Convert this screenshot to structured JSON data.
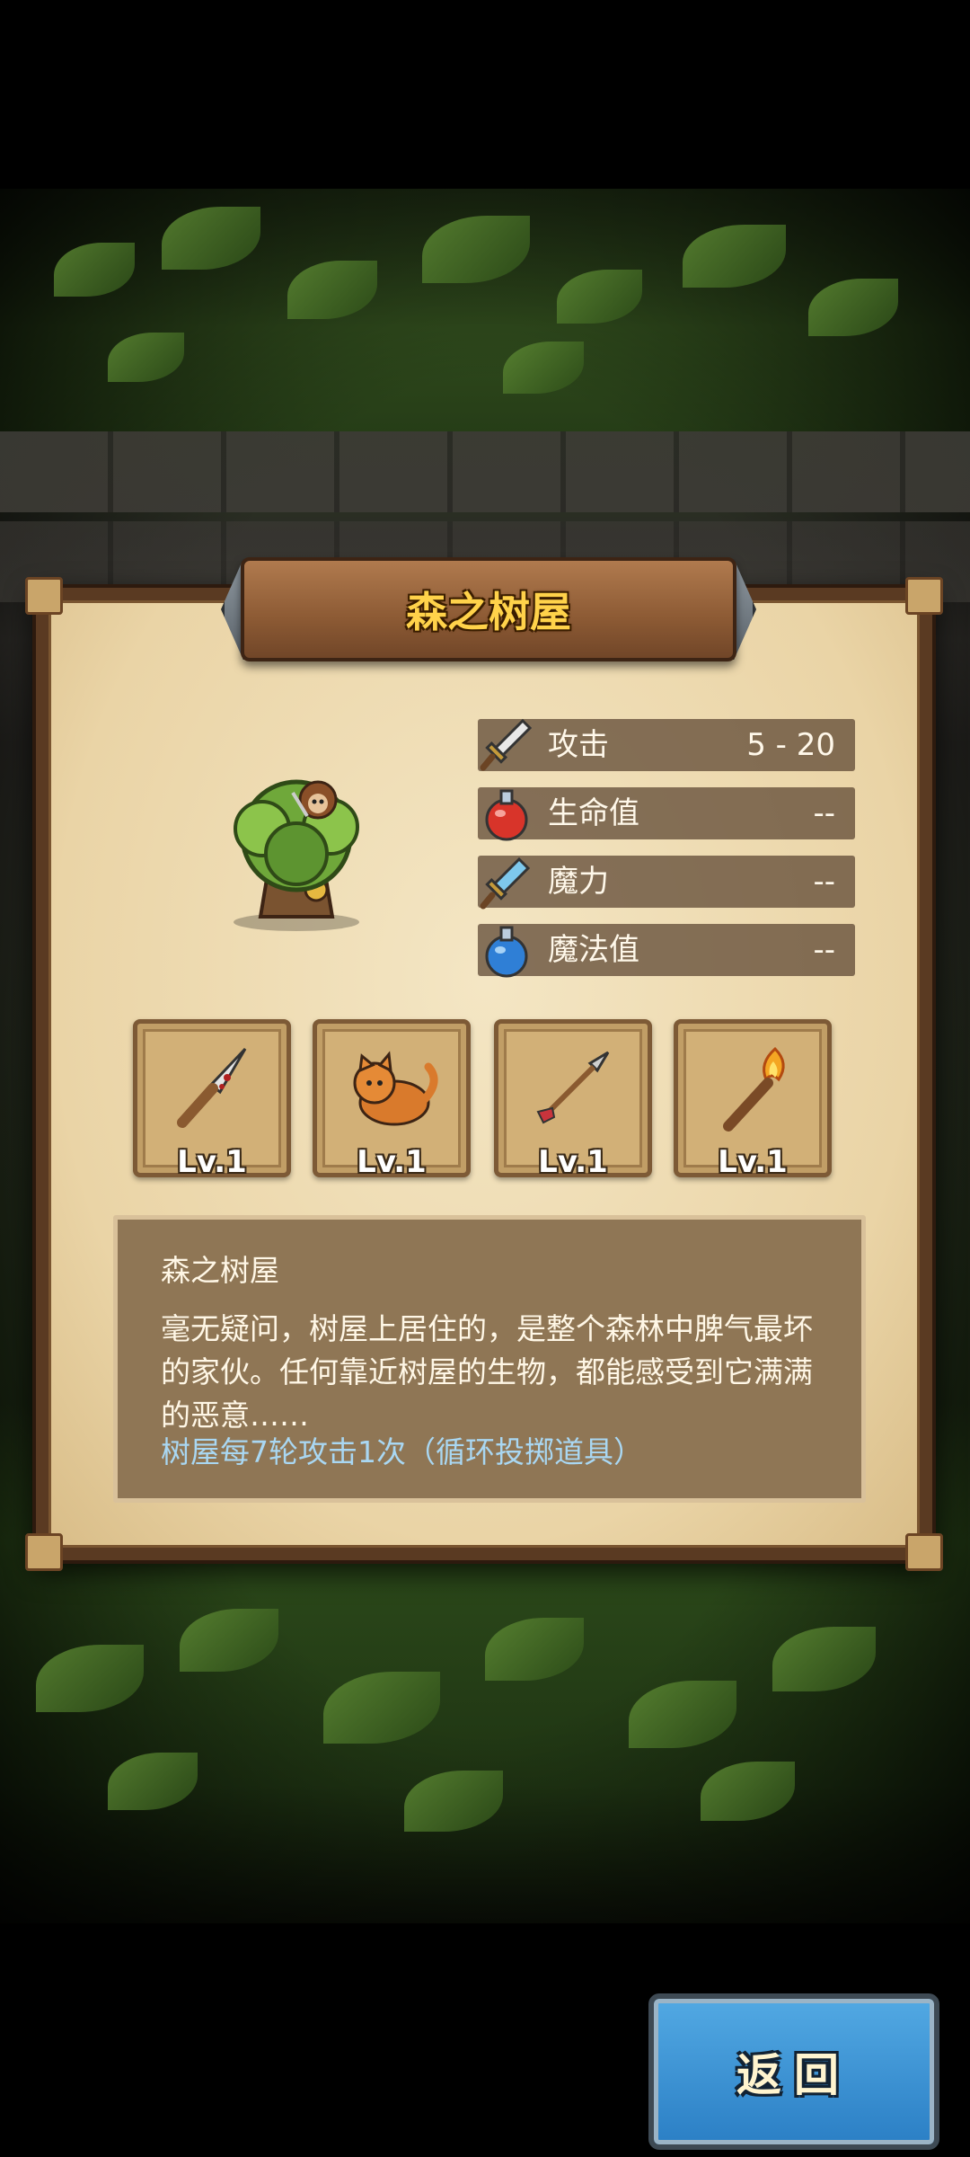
{
  "title": "森之树屋",
  "stats": [
    {
      "label": "攻击",
      "value": "5 - 20",
      "icon": "sword-icon"
    },
    {
      "label": "生命值",
      "value": "--",
      "icon": "red-potion-icon"
    },
    {
      "label": "魔力",
      "value": "--",
      "icon": "magic-sword-icon"
    },
    {
      "label": "魔法值",
      "value": "--",
      "icon": "blue-potion-icon"
    }
  ],
  "equipment": [
    {
      "level": "Lv.1",
      "icon": "dagger-icon"
    },
    {
      "level": "Lv.1",
      "icon": "cat-icon"
    },
    {
      "level": "Lv.1",
      "icon": "arrow-icon"
    },
    {
      "level": "Lv.1",
      "icon": "torch-icon"
    }
  ],
  "description": {
    "title": "森之树屋",
    "body": "毫无疑问，树屋上居住的，是整个森林中脾气最坏的家伙。任何靠近树屋的生物，都能感受到它满满的恶意……",
    "note": "树屋每7轮攻击1次（循环投掷道具）"
  },
  "back_button": "返回"
}
